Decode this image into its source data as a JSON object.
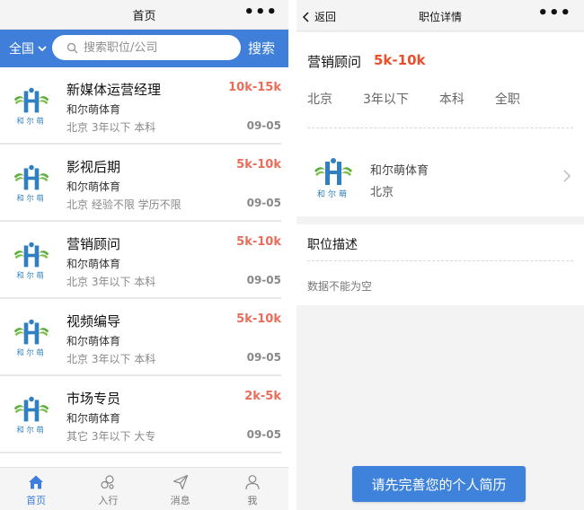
{
  "left": {
    "header": {
      "title": "首页",
      "more": "•••"
    },
    "search": {
      "city": "全国",
      "placeholder": "搜索职位/公司",
      "button": "搜索"
    },
    "jobs": [
      {
        "title": "新媒体运营经理",
        "company": "和尔萌体育",
        "meta": "北京 3年以下 本科",
        "salary": "10k-15k",
        "date": "09-05"
      },
      {
        "title": "影视后期",
        "company": "和尔萌体育",
        "meta": "北京 经验不限 学历不限",
        "salary": "5k-10k",
        "date": "09-05"
      },
      {
        "title": "营销顾问",
        "company": "和尔萌体育",
        "meta": "北京 3年以下 本科",
        "salary": "5k-10k",
        "date": "09-05"
      },
      {
        "title": "视频编导",
        "company": "和尔萌体育",
        "meta": "北京 3年以下 本科",
        "salary": "5k-10k",
        "date": "09-05"
      },
      {
        "title": "市场专员",
        "company": "和尔萌体育",
        "meta": "其它 3年以下 大专",
        "salary": "2k-5k",
        "date": "09-05"
      }
    ],
    "tabs": [
      {
        "label": "首页",
        "icon": "home-icon"
      },
      {
        "label": "入行",
        "icon": "career-icon"
      },
      {
        "label": "消息",
        "icon": "send-icon"
      },
      {
        "label": "我",
        "icon": "user-icon"
      }
    ]
  },
  "right": {
    "header": {
      "back": "返回",
      "title": "职位详情",
      "more": "•••"
    },
    "job": {
      "title": "营销顾问",
      "salary": "5k-10k",
      "tags": [
        "北京",
        "3年以下",
        "本科",
        "全职"
      ]
    },
    "company": {
      "name": "和尔萌体育",
      "city": "北京"
    },
    "description": {
      "title": "职位描述",
      "body": "数据不能为空"
    },
    "cta": "请先完善您的个人简历"
  },
  "logo_text": "和尔萌",
  "colors": {
    "primary": "#3f7fd9",
    "salary": "#ea6c5a",
    "detail_salary": "#ea4e2a"
  }
}
